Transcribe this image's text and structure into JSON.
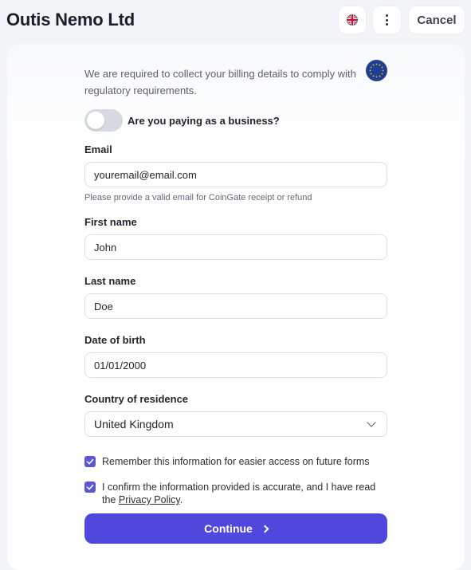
{
  "header": {
    "title": "Outis Nemo Ltd",
    "language_icon": "uk-flag-icon",
    "more_icon": "kebab-menu-icon",
    "cancel_label": "Cancel"
  },
  "form": {
    "intro": "We are required to collect your billing details to comply with regulatory requirements.",
    "region_icon": "eu-flag-icon",
    "business_toggle": {
      "label": "Are you paying as a business?",
      "on": false
    },
    "email": {
      "label": "Email",
      "value": "youremail@email.com",
      "hint": "Please provide a valid email for CoinGate receipt or refund"
    },
    "first_name": {
      "label": "First name",
      "value": "John"
    },
    "last_name": {
      "label": "Last name",
      "value": "Doe"
    },
    "date_of_birth": {
      "label": "Date of birth",
      "value": "01/01/2000"
    },
    "country": {
      "label": "Country of residence",
      "value": "United Kingdom"
    },
    "remember": {
      "label": "Remember this information for easier access on future forms",
      "checked": true
    },
    "confirm": {
      "label_before": "I confirm the information provided is accurate, and I have read the ",
      "link": "Privacy Policy",
      "label_after": ".",
      "checked": true
    },
    "continue_label": "Continue"
  },
  "colors": {
    "accent": "#5048dc",
    "checkbox": "#5b55d8",
    "eu_blue": "#1f3f94",
    "eu_star": "#f5c400"
  }
}
